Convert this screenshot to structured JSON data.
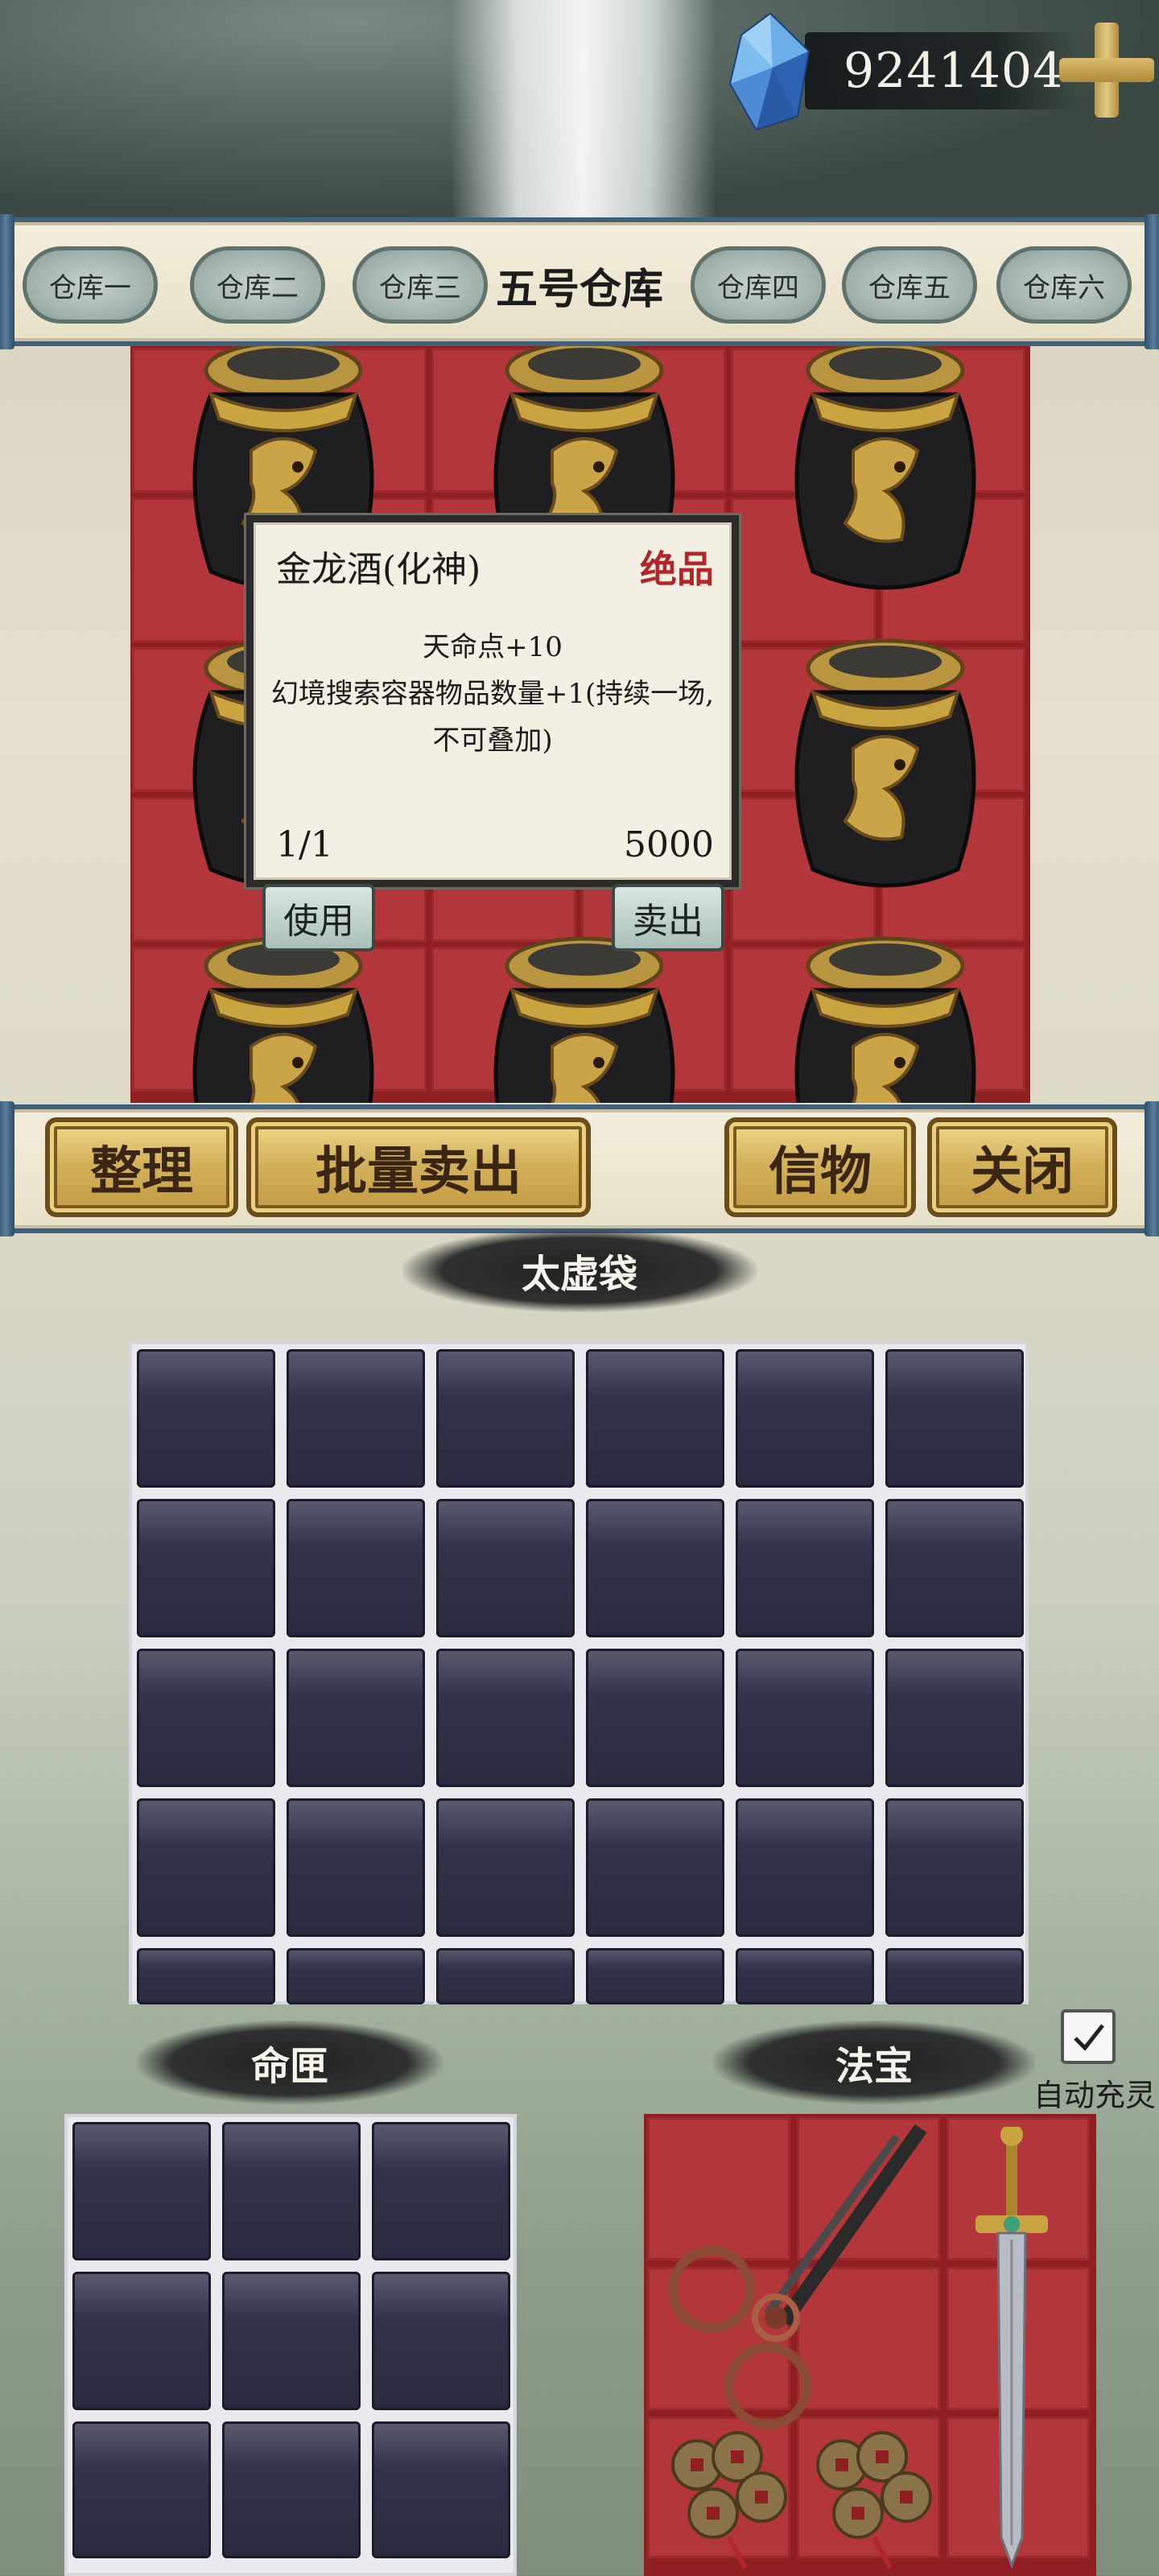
{
  "currency": {
    "amount": "9241404",
    "icon": "crystal-gem-icon",
    "add_icon": "plus-icon"
  },
  "warehouse_tabs": [
    {
      "label": "仓库一"
    },
    {
      "label": "仓库二"
    },
    {
      "label": "仓库三"
    },
    {
      "label": "五号仓库",
      "active": true
    },
    {
      "label": "仓库四"
    },
    {
      "label": "仓库五"
    },
    {
      "label": "仓库六"
    }
  ],
  "warehouse_items": {
    "icon": "golden-dragon-wine-jar-icon",
    "count": 9
  },
  "tooltip": {
    "name": "金龙酒(化神)",
    "grade": "绝品",
    "desc_line1": "天命点+10",
    "desc_line2": "幻境搜索容器物品数量+1(持续一场,",
    "desc_line3": "不可叠加)",
    "count": "1/1",
    "price": "5000",
    "use_label": "使用",
    "sell_label": "卖出"
  },
  "actions": {
    "sort_label": "整理",
    "batch_sell_label": "批量卖出",
    "token_label": "信物",
    "close_label": "关闭"
  },
  "bag": {
    "title": "太虚袋"
  },
  "fate_box": {
    "title": "命匣"
  },
  "treasure": {
    "title": "法宝",
    "auto_charge_label": "自动充灵",
    "auto_charge_checked": true,
    "items": [
      "scissors-icon",
      "sword-icon",
      "coin-string-icon",
      "coin-string-icon"
    ]
  },
  "colors": {
    "grade_red": "#b2262a",
    "warehouse_red": "#8f1f22"
  }
}
